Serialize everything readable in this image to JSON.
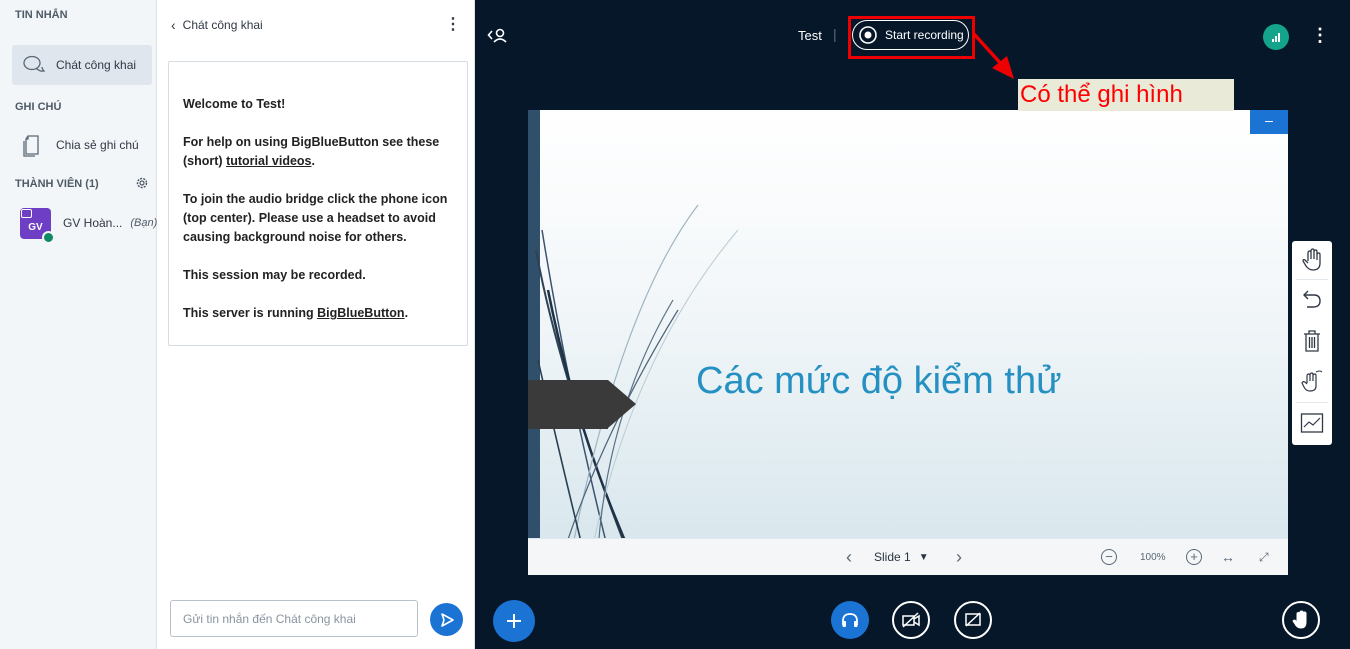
{
  "sidebar": {
    "messages_header": "TIN NHẮN",
    "public_chat_label": "Chát công khai",
    "notes_header": "GHI CHÚ",
    "shared_notes_label": "Chia sẻ ghi chú",
    "users_header": "THÀNH VIÊN (1)",
    "user": {
      "avatar": "GV",
      "name": "GV Hoàn...",
      "you_tag": "(Bạn)"
    }
  },
  "chat": {
    "title": "Chát công khai",
    "welcome": {
      "line1": "Welcome to Test!",
      "line2_before": "For help on using BigBlueButton see these (short) ",
      "line2_link": "tutorial videos",
      "line2_after": ".",
      "line3": "To join the audio bridge click the phone icon (top center). Please use a headset to avoid causing background noise for others.",
      "line4": "This session may be recorded.",
      "line5_before": "This server is running ",
      "line5_link": "BigBlueButton",
      "line5_after": "."
    },
    "input_placeholder": "Gửi tin nhắn đến Chát công khai"
  },
  "topbar": {
    "meeting_title": "Test",
    "record_label": "Start recording"
  },
  "annotation": {
    "text": "Có thể ghi hình",
    "color": "#ff0000"
  },
  "presentation": {
    "slide_title": "Các mức độ kiểm thử",
    "slide_selector": "Slide 1",
    "zoom": "100%"
  },
  "colors": {
    "accent": "#1b74d4",
    "dark_bg": "#06172a",
    "signal": "#14a38b"
  }
}
